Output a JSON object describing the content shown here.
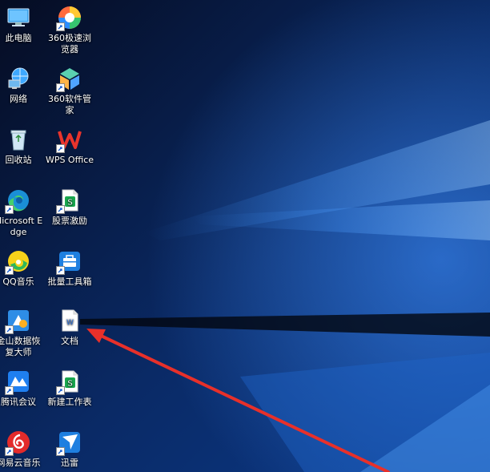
{
  "desktop": {
    "icons": [
      {
        "label": "此电脑",
        "icon": "computer-icon"
      },
      {
        "label": "360极速浏览器",
        "icon": "360-browser-icon"
      },
      {
        "label": "网络",
        "icon": "network-icon"
      },
      {
        "label": "360软件管家",
        "icon": "360-software-manager-icon"
      },
      {
        "label": "回收站",
        "icon": "recycle-bin-icon"
      },
      {
        "label": "WPS Office",
        "icon": "wps-office-icon"
      },
      {
        "label": "Microsoft Edge",
        "icon": "edge-icon"
      },
      {
        "label": "股票激励",
        "icon": "spreadsheet-icon"
      },
      {
        "label": "QQ音乐",
        "icon": "qq-music-icon"
      },
      {
        "label": "批量工具箱",
        "icon": "toolbox-icon"
      },
      {
        "label": "金山数据恢复大师",
        "icon": "data-recovery-icon"
      },
      {
        "label": "文档",
        "icon": "word-document-icon"
      },
      {
        "label": "腾讯会议",
        "icon": "tencent-meeting-icon"
      },
      {
        "label": "新建工作表",
        "icon": "spreadsheet-icon"
      },
      {
        "label": "网易云音乐",
        "icon": "netease-music-icon"
      },
      {
        "label": "迅雷",
        "icon": "xunlei-icon"
      }
    ]
  },
  "colors": {
    "arrow": "#e8302a",
    "wallpaper_dark": "#07122e",
    "wallpaper_light": "#2f7de0"
  }
}
